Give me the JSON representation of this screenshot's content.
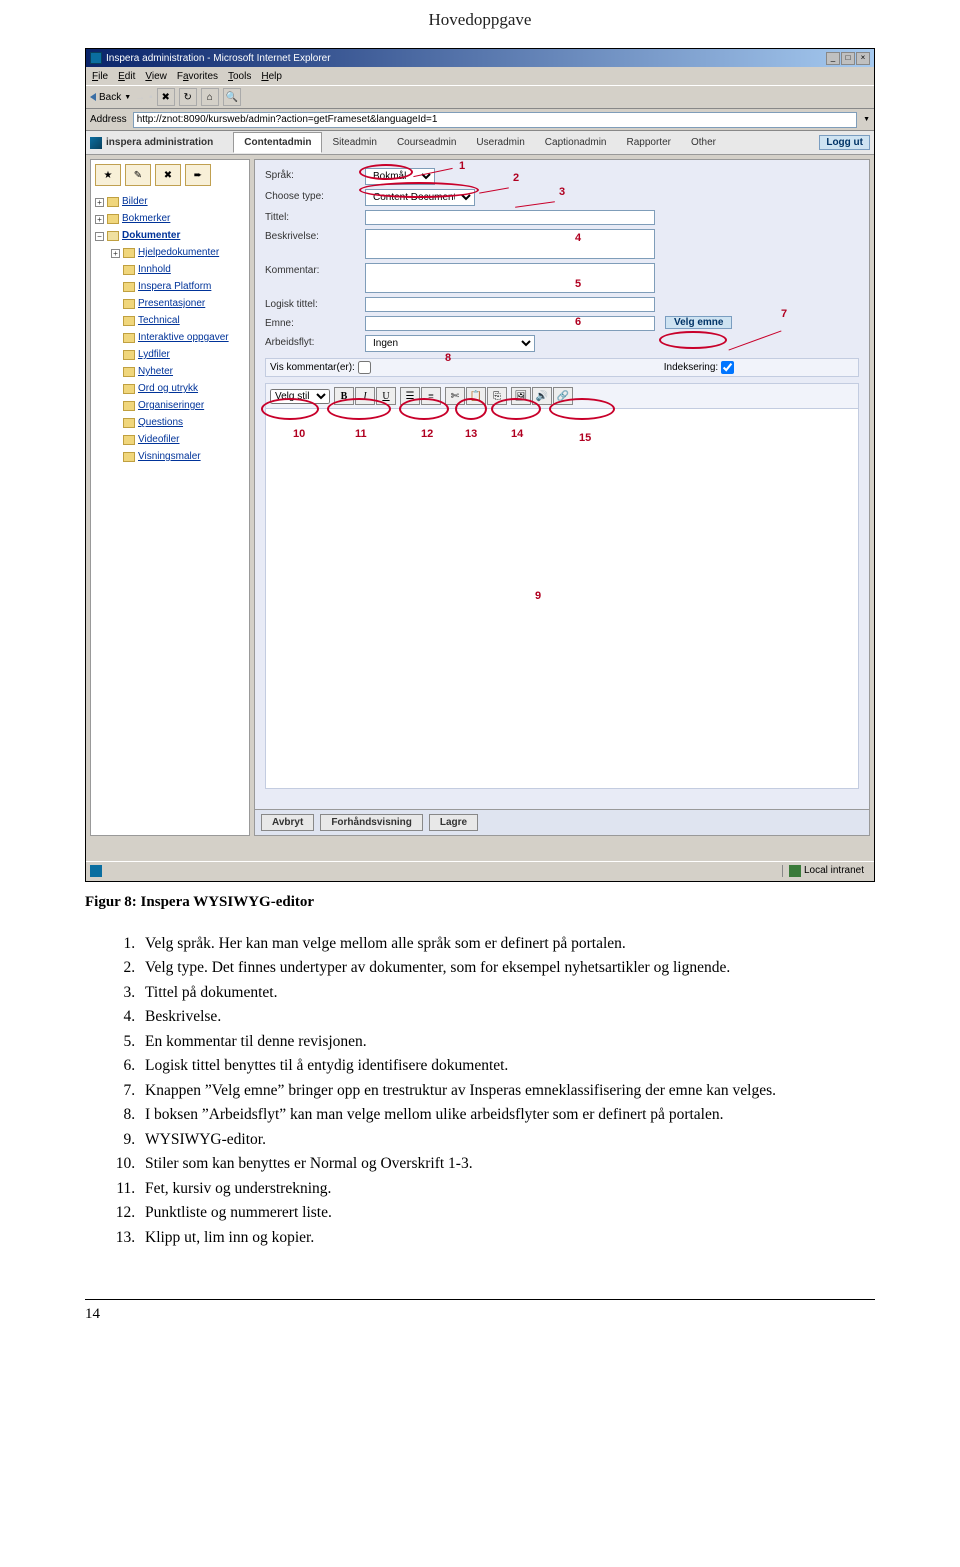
{
  "header": "Hovedoppgave",
  "window_title": "Inspera administration - Microsoft Internet Explorer",
  "ie_menu": [
    "File",
    "Edit",
    "View",
    "Favorites",
    "Tools",
    "Help"
  ],
  "ie_back": "Back",
  "address_label": "Address",
  "address_url": "http://znot:8090/kursweb/admin?action=getFrameset&languageId=1",
  "brand": "inspera administration",
  "tabs": [
    "Contentadmin",
    "Siteadmin",
    "Courseadmin",
    "Useradmin",
    "Captionadmin",
    "Rapporter",
    "Other"
  ],
  "logout": "Logg ut",
  "tree_top": [
    "Bilder",
    "Bokmerker"
  ],
  "tree_sel": "Dokumenter",
  "tree_sub": [
    "Hjelpedokumenter",
    "Innhold",
    "Inspera Platform",
    "Presentasjoner",
    "Technical",
    "Interaktive oppgaver",
    "Lydfiler",
    "Nyheter",
    "Ord og utrykk",
    "Organiseringer",
    "Questions",
    "Videofiler",
    "Visningsmaler"
  ],
  "form": {
    "sprak_label": "Språk:",
    "sprak_value": "Bokmål",
    "choose_label": "Choose type:",
    "choose_value": "Content Document",
    "tittel_label": "Tittel:",
    "beskrivelse_label": "Beskrivelse:",
    "kommentar_label": "Kommentar:",
    "logisk_label": "Logisk tittel:",
    "emne_label": "Emne:",
    "velg_emne": "Velg emne",
    "arbeidsflyt_label": "Arbeidsflyt:",
    "arbeidsflyt_value": "Ingen",
    "vis_kommentar": "Vis kommentar(er):",
    "indeksering": "Indeksering:",
    "style_value": "Velg stil"
  },
  "footer_buttons": [
    "Avbryt",
    "Forhåndsvisning",
    "Lagre"
  ],
  "status_zone": "Local intranet",
  "annotations": {
    "n1": "1",
    "n2": "2",
    "n3": "3",
    "n4": "4",
    "n5": "5",
    "n6": "6",
    "n7": "7",
    "n8": "8",
    "n9": "9",
    "n10": "10",
    "n11": "11",
    "n12": "12",
    "n13": "13",
    "n14": "14",
    "n15": "15"
  },
  "caption": "Figur 8: Inspera WYSIWYG-editor",
  "list": [
    "Velg språk. Her kan man velge mellom alle språk som er definert på portalen.",
    "Velg type. Det finnes undertyper av dokumenter, som for eksempel nyhetsartikler og lignende.",
    "Tittel på dokumentet.",
    "Beskrivelse.",
    "En kommentar til denne revisjonen.",
    "Logisk tittel benyttes til å entydig identifisere dokumentet.",
    "Knappen ”Velg emne” bringer opp en trestruktur av Insperas emneklassifisering der emne kan velges.",
    "I boksen ”Arbeidsflyt” kan man velge mellom ulike arbeidsflyter som er definert på portalen.",
    "WYSIWYG-editor.",
    "Stiler som kan benyttes er Normal og Overskrift 1-3.",
    "Fet, kursiv og understrekning.",
    "Punktliste og nummerert liste.",
    "Klipp ut, lim inn og kopier.",
    ""
  ],
  "page_number": "14"
}
